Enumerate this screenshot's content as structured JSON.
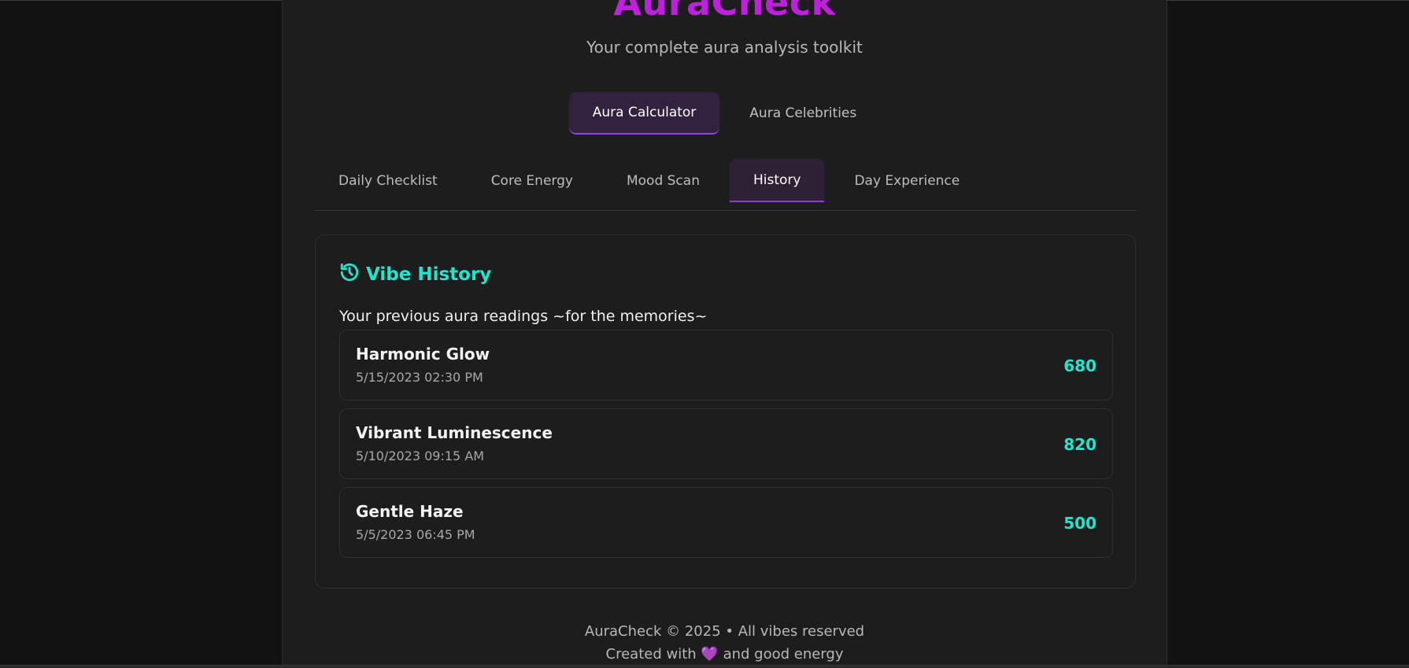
{
  "app": {
    "logo_text": "AuraCheck",
    "subtitle": "Your complete aura analysis toolkit"
  },
  "main_tabs": [
    {
      "label": "Aura Calculator",
      "active": true
    },
    {
      "label": "Aura Celebrities",
      "active": false
    }
  ],
  "sub_tabs": [
    {
      "label": "Daily Checklist",
      "active": false
    },
    {
      "label": "Core Energy",
      "active": false
    },
    {
      "label": "Mood Scan",
      "active": false
    },
    {
      "label": "History",
      "active": true
    },
    {
      "label": "Day Experience",
      "active": false
    }
  ],
  "history": {
    "title": "Vibe History",
    "title_icon": "history-icon",
    "description": "Your previous aura readings ~for the memories~",
    "readings": [
      {
        "name": "Harmonic Glow",
        "date": "5/15/2023 02:30 PM",
        "score": "680"
      },
      {
        "name": "Vibrant Luminescence",
        "date": "5/10/2023 09:15 AM",
        "score": "820"
      },
      {
        "name": "Gentle Haze",
        "date": "5/5/2023 06:45 PM",
        "score": "500"
      }
    ]
  },
  "footer": {
    "line1": "AuraCheck © 2025 • All vibes reserved",
    "line2_prefix": "Created with",
    "line2_heart": "💜",
    "line2_suffix": "and good energy"
  },
  "colors": {
    "logo": "#c11fe0",
    "accent_teal": "#1de8cf",
    "accent_purple": "#9b3ee0",
    "background": "#1d1d1d"
  }
}
